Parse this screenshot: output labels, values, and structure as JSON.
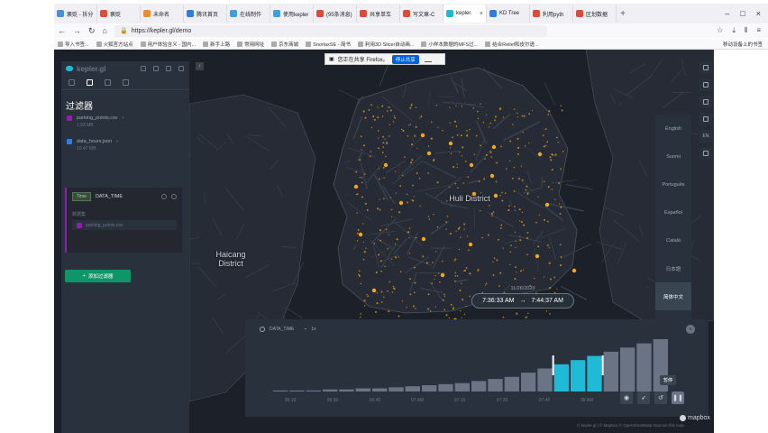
{
  "browser": {
    "tabs": [
      {
        "label": "褒贬 - 拆分",
        "color": "#4a90e2"
      },
      {
        "label": "褒贬",
        "color": "#e04a3a"
      },
      {
        "label": "未命名",
        "color": "#f28c28"
      },
      {
        "label": "腾讯首页",
        "color": "#2b7de9"
      },
      {
        "label": "在线制作",
        "color": "#3aa0e0"
      },
      {
        "label": "使用kepler",
        "color": "#3aa0e0"
      },
      {
        "label": "(95条消息)",
        "color": "#e04a3a"
      },
      {
        "label": "共享单车",
        "color": "#e04a3a"
      },
      {
        "label": "写文章-C",
        "color": "#e04a3a"
      },
      {
        "label": "kepler.",
        "color": "#1fbad6"
      },
      {
        "label": "KD Tree",
        "color": "#2b7de9"
      },
      {
        "label": "利用pyth",
        "color": "#e04a3a"
      },
      {
        "label": "区划数据",
        "color": "#e04a3a"
      }
    ],
    "active_tab": 9,
    "url": "https://kepler.gl/demo",
    "bookmarks": [
      "导入书签...",
      "火狐官方站点",
      "用户体验含义 - 国内...",
      "新手上路",
      "常用网址",
      "京东商城",
      "SnorlaxSE - 简书",
      "利用3D Slicer自动画...",
      "小样本数据的MFS过...",
      "结合Relief和皮尔逊..."
    ],
    "bookmarks_right": "移动设备上的书签",
    "share_notice": "您正在共享 Firefox。",
    "share_stop": "停止共享"
  },
  "sidebar": {
    "logo": "kepler.gl",
    "title": "过滤器",
    "datasets": [
      {
        "name": "parking_points.csv",
        "meta": "1.93 MB",
        "color": "#8f1db0"
      },
      {
        "name": "data_hours.json",
        "meta": "10.47 MB",
        "color": "#2b7de9"
      }
    ],
    "filter": {
      "tag": "Time",
      "field": "DATA_TIME",
      "dataset_label": "数据集",
      "dataset_value": "parking_points.csv"
    },
    "add_filter": "添加过滤器"
  },
  "map": {
    "labels": [
      {
        "text": "Huli District",
        "lines": [
          "Huli District"
        ]
      },
      {
        "text": "Haicang District",
        "lines": [
          "Haicang",
          "District"
        ]
      }
    ],
    "colors": {
      "background": "#1c2029",
      "water": "#1c2029",
      "land": "#262b35",
      "roads": "#39414d",
      "points": "#f7a817"
    }
  },
  "languages": [
    "English",
    "Suomi",
    "Português",
    "Español",
    "Català",
    "日本語",
    "简体中文",
    "Русский"
  ],
  "active_language": 6,
  "lang_button": "EN",
  "time_tooltip": {
    "date": "11/26/2020",
    "start": "7:36:33 AM",
    "arrow": "→",
    "end": "7:44:37 AM"
  },
  "time_panel": {
    "field": "DATA_TIME",
    "speed": "1x",
    "ticks": [
      "06:15",
      "06:30",
      "06:45",
      "07 AM",
      "07:15",
      "07:30",
      "07:45",
      "08 AM"
    ],
    "pause_tooltip": "暂停",
    "chart_data": {
      "type": "bar",
      "title": "",
      "xlabel": "DATA_TIME",
      "ylabel": "",
      "categories": [
        "06:05",
        "06:10",
        "06:15",
        "06:20",
        "06:25",
        "06:30",
        "06:35",
        "06:40",
        "06:45",
        "06:50",
        "06:55",
        "07:00",
        "07:05",
        "07:10",
        "07:15",
        "07:20",
        "07:25",
        "07:30",
        "07:35",
        "07:40",
        "07:45",
        "07:50",
        "07:55",
        "08:00"
      ],
      "values": [
        1,
        1,
        1,
        2,
        2,
        3,
        3,
        4,
        5,
        6,
        7,
        8,
        10,
        12,
        14,
        18,
        22,
        26,
        30,
        34,
        38,
        42,
        46,
        50
      ],
      "highlight_range": [
        "07:36:33",
        "07:44:37"
      ],
      "colors": {
        "bars": "#6a7485",
        "selected": "#1fbad6",
        "handles": "#ffffff"
      }
    }
  },
  "attribution": "© kepler.gl | © Mapbox © OpenStreetMap  Improve this map",
  "mapbox_logo": "mapbox"
}
